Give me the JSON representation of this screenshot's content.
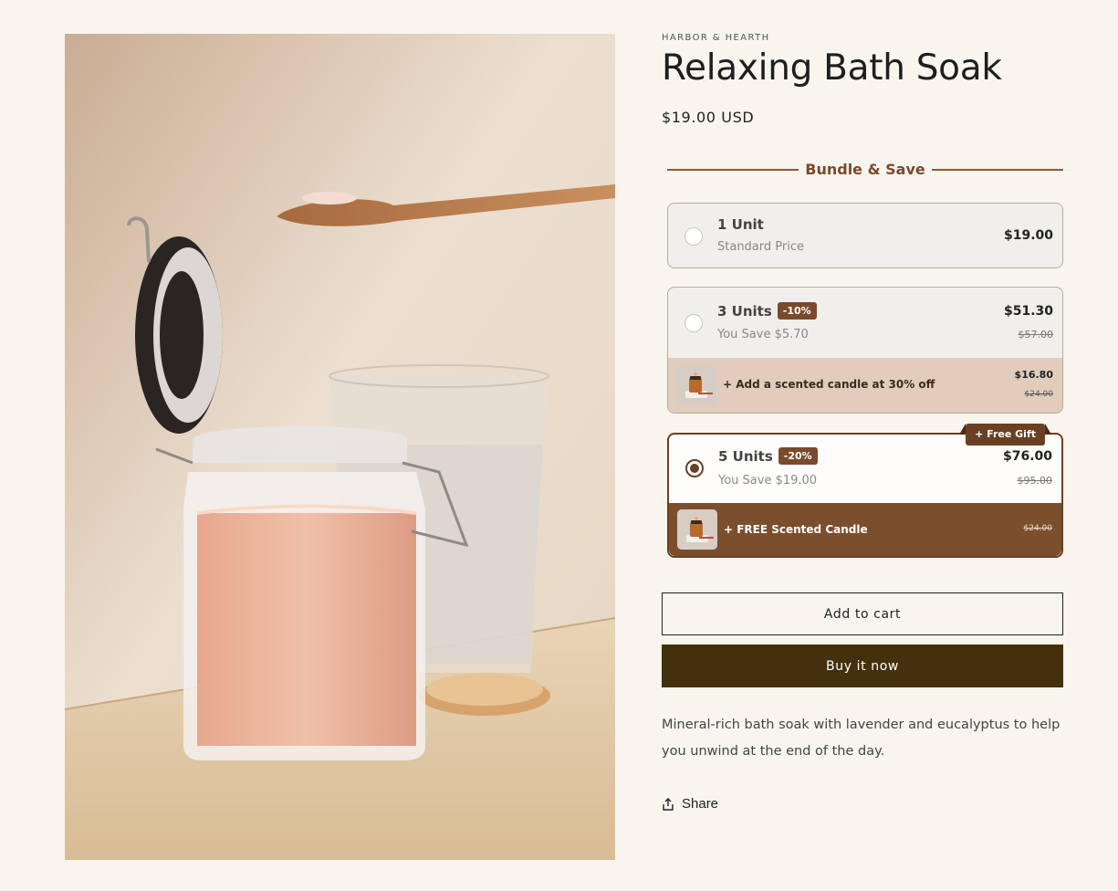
{
  "product": {
    "vendor": "HARBOR & HEARTH",
    "title": "Relaxing Bath Soak",
    "price": "$19.00 USD",
    "description": "Mineral-rich bath soak with lavender and eucalyptus to help you unwind at the end of the day."
  },
  "bundle": {
    "heading": "Bundle & Save",
    "options": [
      {
        "name": "1 Unit",
        "subtitle": "Standard Price",
        "price": "$19.00",
        "selected": false
      },
      {
        "name": "3 Units",
        "badge": "-10%",
        "subtitle": "You Save $5.70",
        "price": "$51.30",
        "compare_price": "$57.00",
        "selected": false,
        "addon": {
          "text": "+ Add a scented candle at 30% off",
          "price": "$16.80",
          "compare_price": "$24.00"
        }
      },
      {
        "name": "5 Units",
        "badge": "-20%",
        "subtitle": "You Save $19.00",
        "price": "$76.00",
        "compare_price": "$95.00",
        "selected": true,
        "tag": "+ Free Gift",
        "addon": {
          "text": "+ FREE Scented Candle",
          "compare_price": "$24.00"
        }
      }
    ]
  },
  "actions": {
    "add_to_cart": "Add to cart",
    "buy_now": "Buy it now",
    "share": "Share"
  },
  "colors": {
    "accent": "#7a4a2c",
    "buy_button": "#45300d",
    "background": "#f8f5ef"
  },
  "icons": {
    "share": "share-icon"
  }
}
